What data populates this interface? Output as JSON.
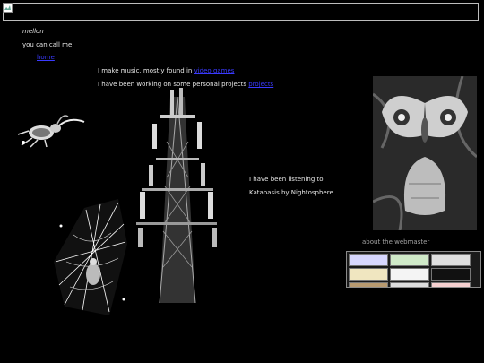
{
  "header": {
    "banner_icon": "broken-image-icon"
  },
  "intro": {
    "name": "mellon",
    "call_me": "you can call me",
    "home_link": "home"
  },
  "about_lines": {
    "music_prefix": "I make music, mostly found in",
    "music_link": "video games",
    "projects_prefix": "I have been working on some personal projects",
    "projects_link": "projects"
  },
  "listening": {
    "line1": "I have been listening to",
    "line2": "Katabasis by Nightosphere"
  },
  "sidebar": {
    "about_webmaster": "about the webmaster"
  },
  "images": {
    "beetle": "beetle-illustration",
    "tower": "cell-tower-photo",
    "spider": "spider-web-illustration",
    "moth": "moth-photo"
  },
  "colors": {
    "background": "#000000",
    "text": "#e6e6e6",
    "link": "#3a3aff",
    "muted": "#a0a0a0"
  }
}
